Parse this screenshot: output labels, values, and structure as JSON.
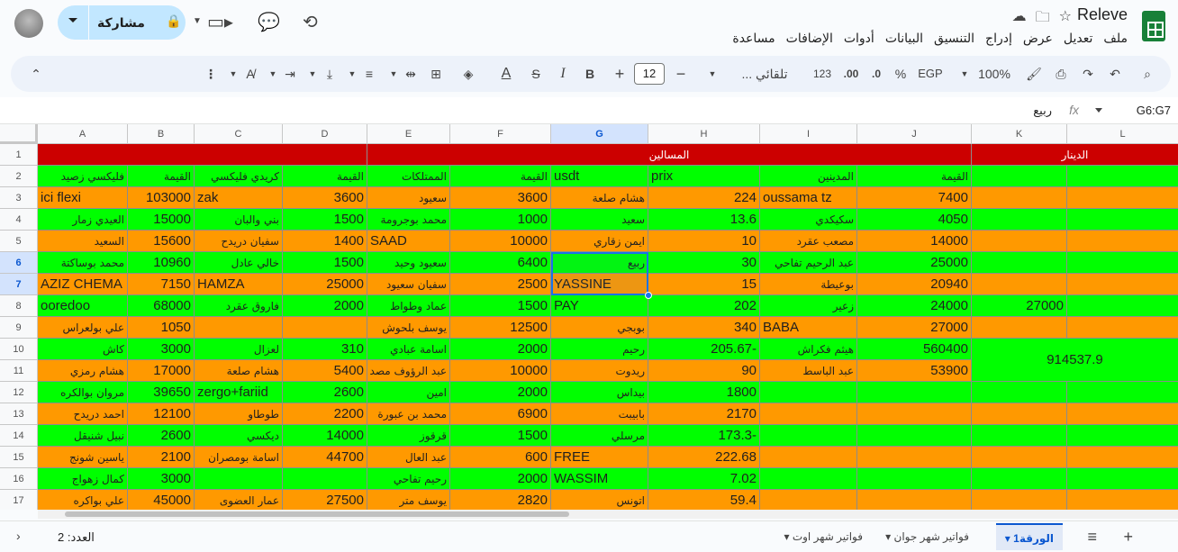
{
  "header": {
    "doc_title": "Releve",
    "menus": [
      "ملف",
      "تعديل",
      "عرض",
      "إدراج",
      "التنسيق",
      "البيانات",
      "أدوات",
      "الإضافات",
      "مساعدة"
    ],
    "share_label": "مشاركة"
  },
  "toolbar": {
    "zoom": "100%",
    "currency": "EGP",
    "percent": "%",
    "dec_less": ".0",
    "dec_more": ".00",
    "format_123": "123",
    "font": "تلقائي ...",
    "font_size": "12",
    "bold": "B",
    "italic": "I",
    "strike": "S",
    "text_color": "A"
  },
  "formula_bar": {
    "name_box": "G6:G7",
    "value": "ربيع"
  },
  "columns": [
    "A",
    "B",
    "C",
    "D",
    "E",
    "F",
    "G",
    "H",
    "I",
    "J",
    "K",
    "L"
  ],
  "rows": [
    {
      "n": "1",
      "cells": {
        "E_merged": "المسالين",
        "K_merged": "الدينار"
      }
    },
    {
      "n": "2",
      "cells": {
        "A": "فليكسي زصيد",
        "B": "القيمة",
        "C": "كريدي فليكسي",
        "D": "القيمة",
        "E": "الممتلكات",
        "F": "القيمة",
        "G": "usdt",
        "H": "prix",
        "I": "المدينين",
        "J": "القيمة",
        "K": "",
        "L": ""
      }
    },
    {
      "n": "3",
      "cells": {
        "A": "ici flexi",
        "B": "103000",
        "C": "zak",
        "D": "3600",
        "E": "سعيود",
        "F": "3600",
        "G": "هشام صلعة",
        "H": "224",
        "I": "oussama tz",
        "J": "7400",
        "K": "",
        "L": ""
      }
    },
    {
      "n": "4",
      "cells": {
        "A": "العيدي زمار",
        "B": "15000",
        "C": "بني والبان",
        "D": "1500",
        "E": "محمد بوجرومة",
        "F": "1000",
        "G": "سعيد",
        "H": "13.6",
        "I": "سكيكدي",
        "J": "4050",
        "K": "",
        "L": ""
      }
    },
    {
      "n": "5",
      "cells": {
        "A": "السعيد",
        "B": "15600",
        "C": "سفيان دريدح",
        "D": "1400",
        "E": "SAAD",
        "F": "10000",
        "G": "ايمن زقاري",
        "H": "10",
        "I": "مصعب عقرد",
        "J": "14000",
        "K": "",
        "L": ""
      }
    },
    {
      "n": "6",
      "cells": {
        "A": "محمد بوساكتة",
        "B": "10960",
        "C": "خالي عادل",
        "D": "1500",
        "E": "سعيود وحيد",
        "F": "6400",
        "G": "ربيع",
        "H": "30",
        "I": "عبد الرحيم تفاحي",
        "J": "25000",
        "K": "",
        "L": ""
      }
    },
    {
      "n": "7",
      "cells": {
        "A": "AZIZ CHEMA",
        "B": "7150",
        "C": "HAMZA",
        "D": "25000",
        "E": "سفيان سعيود",
        "F": "2500",
        "G": "YASSINE",
        "H": "15",
        "I": "بوعيطة",
        "J": "20940",
        "K": "",
        "L": ""
      }
    },
    {
      "n": "8",
      "cells": {
        "A": "ooredoo",
        "B": "68000",
        "C": "فاروق عقرد",
        "D": "2000",
        "E": "عماد وطواط",
        "F": "1500",
        "G": "PAY",
        "H": "202",
        "I": "زعير",
        "J": "24000",
        "K": "27000",
        "L": ""
      }
    },
    {
      "n": "9",
      "cells": {
        "A": "علي بولعراس",
        "B": "1050",
        "C": "",
        "D": "",
        "E": "يوسف بلحوش",
        "F": "12500",
        "G": "بوبجي",
        "H": "340",
        "I": "BABA",
        "J": "27000",
        "K": "",
        "L": ""
      }
    },
    {
      "n": "10",
      "cells": {
        "A": "كاش",
        "B": "3000",
        "C": "لعزال",
        "D": "310",
        "E": "اسامة عبادي",
        "F": "2000",
        "G": "رحيم",
        "H": "205.67-",
        "I": "هيثم فكراش",
        "J": "560400",
        "K_merged": "914537.9"
      }
    },
    {
      "n": "11",
      "cells": {
        "A": "هشام رمزي",
        "B": "17000",
        "C": "هشام صلعة",
        "D": "5400",
        "E": "عبد الرؤوف مصد",
        "F": "10000",
        "G": "ريدوت",
        "H": "90",
        "I": "عبد الباسط",
        "J": "53900"
      }
    },
    {
      "n": "12",
      "cells": {
        "A": "مروان بوالكره",
        "B": "39650",
        "C": "zergo+fariid",
        "D": "2600",
        "E": "امين",
        "F": "2000",
        "G": "بيداس",
        "H": "1800",
        "I": "",
        "J": "",
        "K": "",
        "L": ""
      }
    },
    {
      "n": "13",
      "cells": {
        "A": "احمد دريدح",
        "B": "12100",
        "C": "طوطاو",
        "D": "2200",
        "E": "محمد بن عبورة",
        "F": "6900",
        "G": "بابيبت",
        "H": "2170",
        "I": "",
        "J": "",
        "K": "",
        "L": ""
      }
    },
    {
      "n": "14",
      "cells": {
        "A": "نبيل شنيقل",
        "B": "2600",
        "C": "ديكسي",
        "D": "14000",
        "E": "قرقوز",
        "F": "1500",
        "G": "مرسلي",
        "H": "173.3-",
        "I": "",
        "J": "",
        "K": "",
        "L": ""
      }
    },
    {
      "n": "15",
      "cells": {
        "A": "ياسين شونج",
        "B": "2100",
        "C": "اسامة بومصران",
        "D": "44700",
        "E": "عبد العال",
        "F": "600",
        "G": "FREE",
        "H": "222.68",
        "I": "",
        "J": "",
        "K": "",
        "L": ""
      }
    },
    {
      "n": "16",
      "cells": {
        "A": "كمال زهواج",
        "B": "3000",
        "C": "",
        "D": "",
        "E": "رحيم تفاحي",
        "F": "2000",
        "G": "WASSIM",
        "H": "7.02",
        "I": "",
        "J": "",
        "K": "",
        "L": ""
      }
    },
    {
      "n": "17",
      "cells": {
        "A": "علي بواكره",
        "B": "45000",
        "C": "عمار العضوى",
        "D": "27500",
        "E": "يوسف متر",
        "F": "2820",
        "G": "اتونس",
        "H": "59.4",
        "I": "",
        "J": "",
        "K": "",
        "L": ""
      }
    }
  ],
  "sheets": {
    "add": "+",
    "all": "≡",
    "tabs": [
      "الورقة1",
      "فواتير شهر جوان",
      "فواتير شهر اوت"
    ],
    "count_label": "العدد: 2"
  },
  "colors": {
    "green": "#00ff00",
    "orange": "#ff9900",
    "red": "#cc0000",
    "selection": "#1a73e8"
  }
}
